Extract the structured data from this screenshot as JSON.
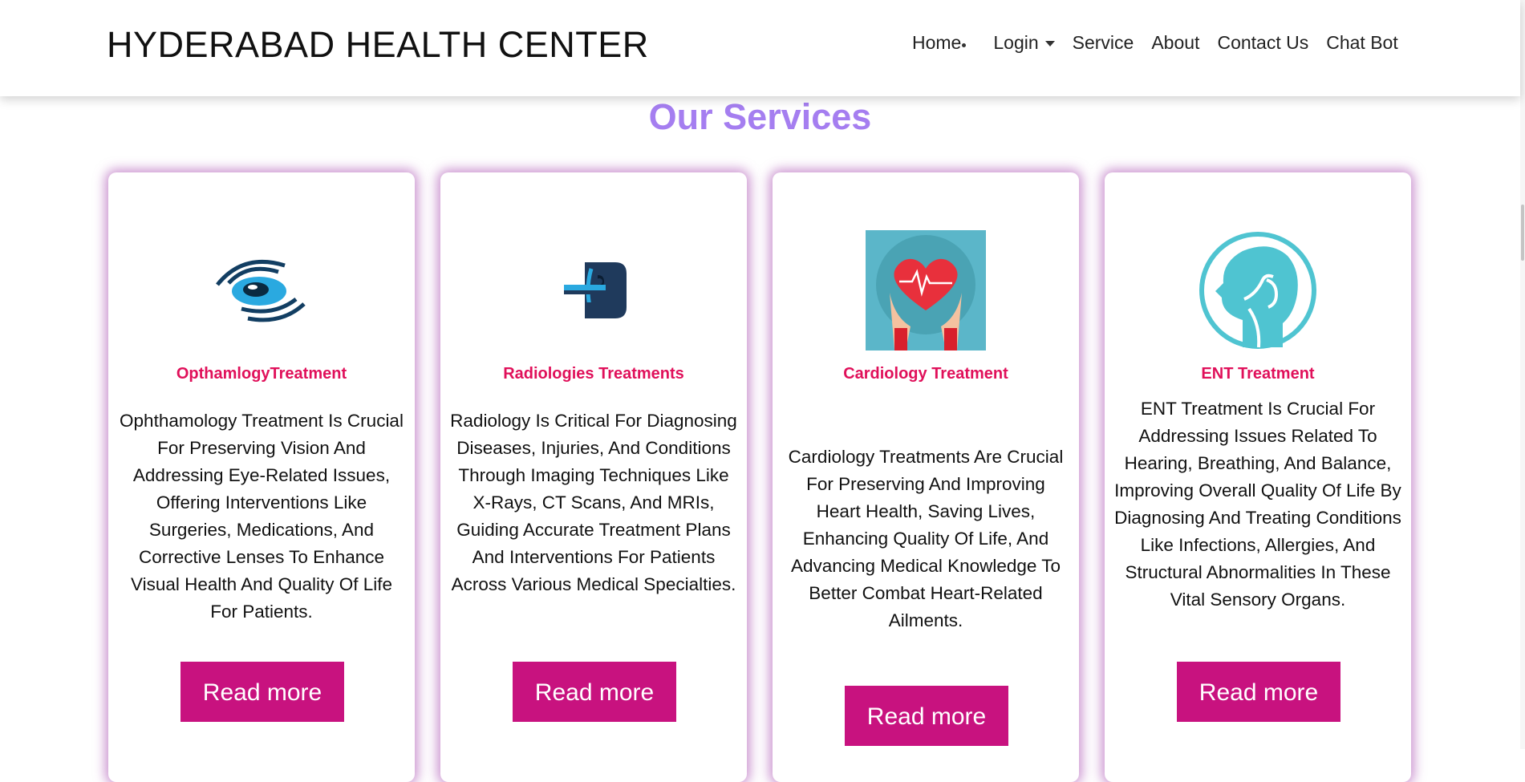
{
  "header": {
    "brand": "HYDERABAD HEALTH CENTER",
    "nav": {
      "home": "Home",
      "login": "Login",
      "service": "Service",
      "about": "About",
      "contact": "Contact Us",
      "chatbot": "Chat Bot"
    }
  },
  "section_title": "Our Services",
  "cards": [
    {
      "title": "OpthamlogyTreatment",
      "text": "Ophthamology Treatment Is Crucial For Preserving Vision And Addressing Eye-Related Issues, Offering Interventions Like Surgeries, Medications, And Corrective Lenses To Enhance Visual Health And Quality Of Life For Patients.",
      "button": "Read more",
      "icon": "eye-icon"
    },
    {
      "title": "Radiologies Treatments",
      "text": "Radiology Is Critical For Diagnosing Diseases, Injuries, And Conditions Through Imaging Techniques Like X-Rays, CT Scans, And MRIs, Guiding Accurate Treatment Plans And Interventions For Patients Across Various Medical Specialties.",
      "button": "Read more",
      "icon": "mri-scanner-icon"
    },
    {
      "title": "Cardiology Treatment",
      "text": "Cardiology Treatments Are Crucial For Preserving And Improving Heart Health, Saving Lives, Enhancing Quality Of Life, And Advancing Medical Knowledge To Better Combat Heart-Related Ailments.",
      "button": "Read more",
      "icon": "heart-hands-icon"
    },
    {
      "title": "ENT Treatment",
      "text": "ENT Treatment Is Crucial For Addressing Issues Related To Hearing, Breathing, And Balance, Improving Overall Quality Of Life By Diagnosing And Treating Conditions Like Infections, Allergies, And Structural Abnormalities In These Vital Sensory Organs.",
      "button": "Read more",
      "icon": "ent-head-icon"
    }
  ],
  "colors": {
    "accent_title": "#a57ef0",
    "card_title": "#e0105a",
    "button_bg": "#c8127f",
    "card_glow": "#a03caa"
  }
}
